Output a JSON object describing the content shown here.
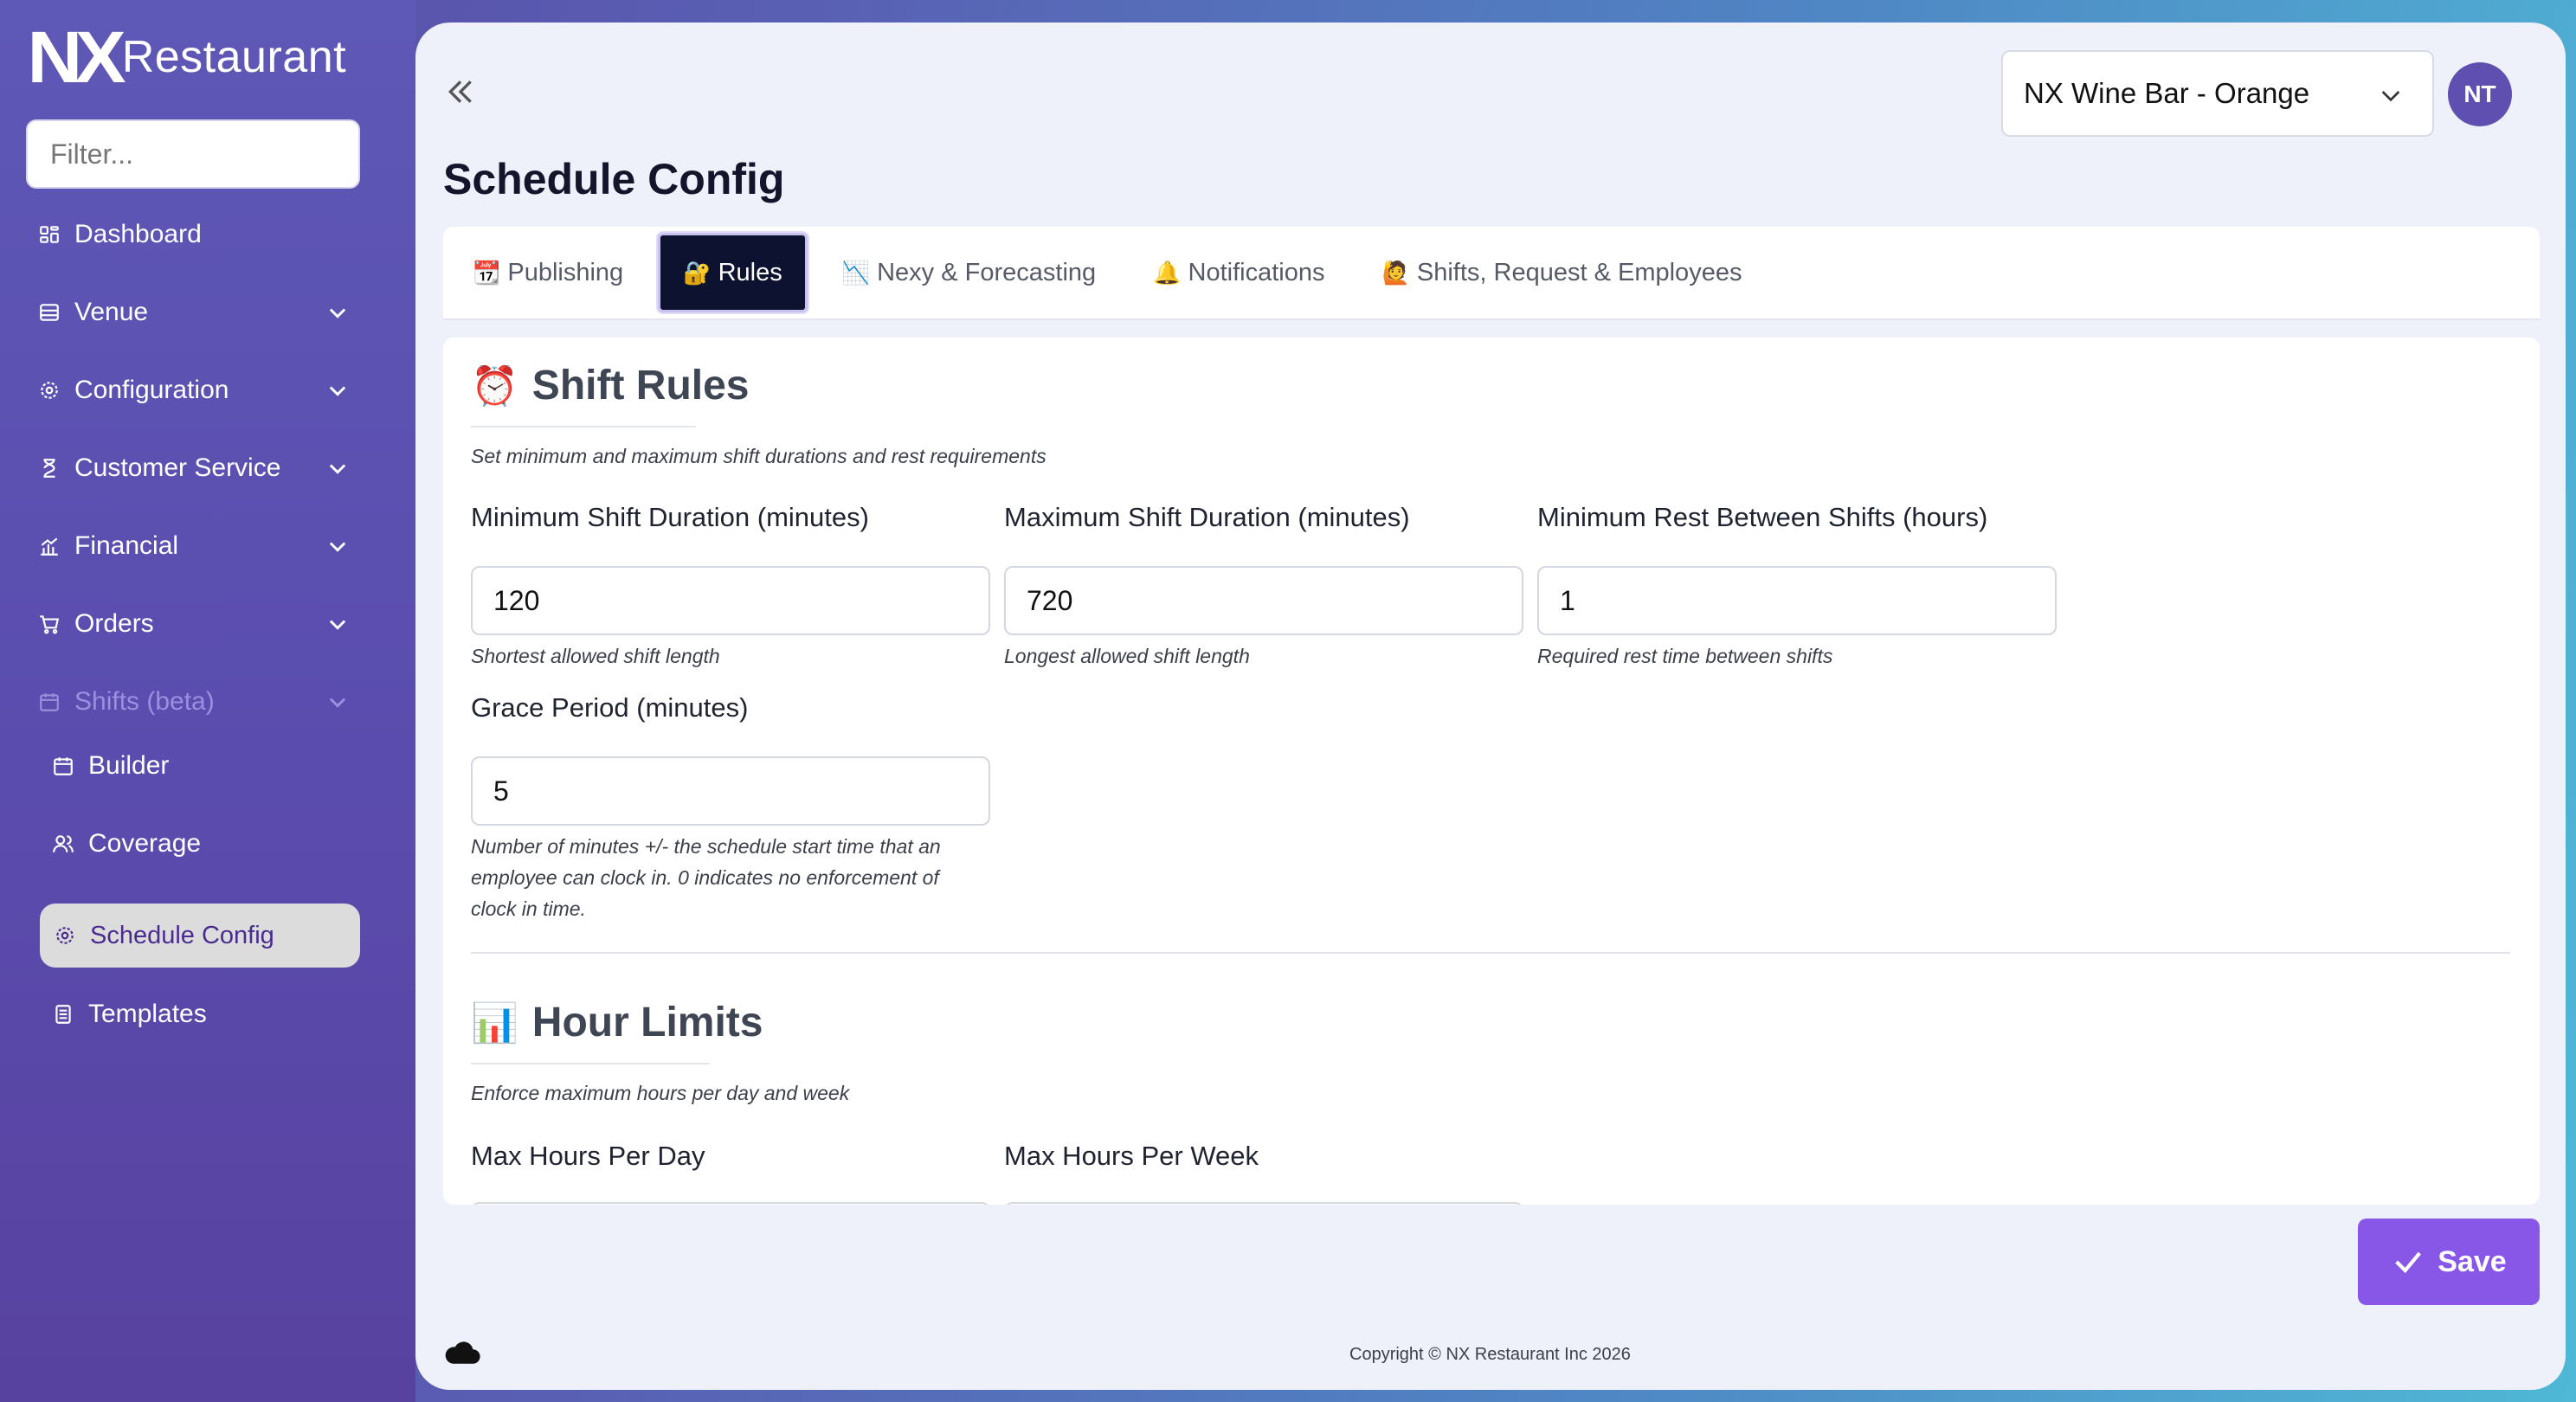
{
  "sidebar": {
    "brand_logo": "NX",
    "brand_text": "Restaurant",
    "filter_placeholder": "Filter...",
    "items": [
      {
        "label": "Dashboard",
        "icon": "dashboard-icon"
      },
      {
        "label": "Venue",
        "icon": "venue-icon"
      },
      {
        "label": "Configuration",
        "icon": "gear-icon"
      },
      {
        "label": "Customer Service",
        "icon": "customer-service-icon"
      },
      {
        "label": "Financial",
        "icon": "chart-icon"
      },
      {
        "label": "Orders",
        "icon": "cart-icon"
      },
      {
        "label": "Shifts (beta)",
        "icon": "calendar-icon"
      }
    ],
    "shifts_sub": [
      {
        "label": "Builder",
        "icon": "calendar-icon"
      },
      {
        "label": "Coverage",
        "icon": "users-icon"
      },
      {
        "label": "Schedule Config",
        "icon": "gear-icon"
      },
      {
        "label": "Templates",
        "icon": "template-icon"
      }
    ]
  },
  "header": {
    "venue": "NX Wine Bar - Orange",
    "avatar_initials": "NT"
  },
  "page_title": "Schedule Config",
  "tabs": [
    {
      "emoji": "📆",
      "label": "Publishing"
    },
    {
      "emoji": "🔐",
      "label": "Rules"
    },
    {
      "emoji": "📉",
      "label": "Nexy & Forecasting"
    },
    {
      "emoji": "🔔",
      "label": "Notifications"
    },
    {
      "emoji": "🙋",
      "label": "Shifts, Request & Employees"
    }
  ],
  "active_tab": "Rules",
  "shift_rules": {
    "emoji": "⏰",
    "title": "Shift Rules",
    "description": "Set minimum and maximum shift durations and rest requirements",
    "min_shift": {
      "label": "Minimum Shift Duration (minutes)",
      "value": "120",
      "help": "Shortest allowed shift length"
    },
    "max_shift": {
      "label": "Maximum Shift Duration (minutes)",
      "value": "720",
      "help": "Longest allowed shift length"
    },
    "min_rest": {
      "label": "Minimum Rest Between Shifts (hours)",
      "value": "1",
      "help": "Required rest time between shifts"
    },
    "grace": {
      "label": "Grace Period (minutes)",
      "value": "5",
      "help_lines": [
        "Number of minutes +/- the schedule start time that an",
        "employee can clock in. 0 indicates no enforcement of",
        "clock in time."
      ]
    }
  },
  "hour_limits": {
    "emoji": "📊",
    "title": "Hour Limits",
    "description": "Enforce maximum hours per day and week",
    "max_day_label": "Max Hours Per Day",
    "max_week_label": "Max Hours Per Week"
  },
  "save_label": "Save",
  "copyright": "Copyright © NX Restaurant Inc 2026",
  "colors": {
    "accent": "#8857e8",
    "active_tab_bg": "#0d1230",
    "avatar_bg": "#5f4fb0",
    "sidebar_bg": "#5a4cae"
  }
}
